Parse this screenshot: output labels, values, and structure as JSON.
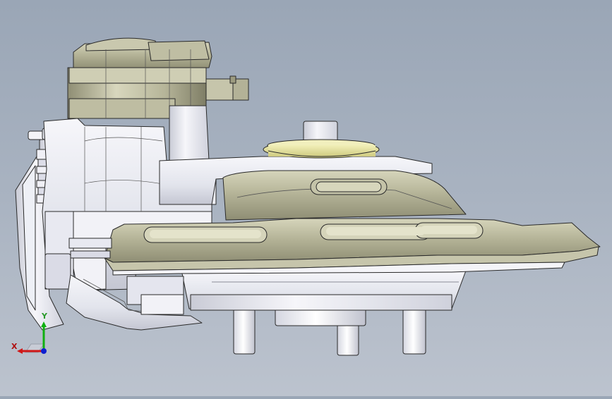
{
  "triad": {
    "x_label": "X",
    "y_label": "Y",
    "colors": {
      "x": "#d01818",
      "y": "#10b010",
      "z": "#1020d0"
    }
  },
  "model": {
    "colors": {
      "metal_light": "#e8eaf2",
      "metal_white": "#f4f4f8",
      "metal_mid": "#c8cad6",
      "olive_light": "#c9c8ae",
      "olive_mid": "#a9a88c",
      "olive_dark": "#8d8c72",
      "yellow_ring": "#e7e4a0",
      "edge": "#2a2a2a"
    }
  }
}
